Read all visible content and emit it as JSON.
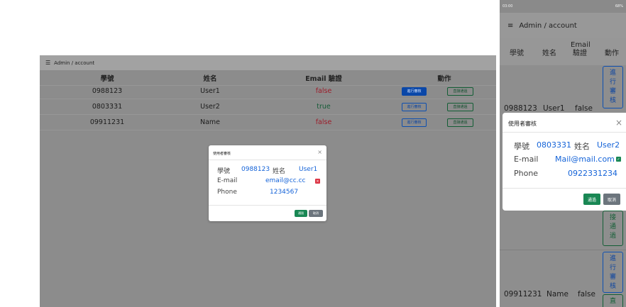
{
  "desktop": {
    "breadcrumb": "Admin / account",
    "columns": [
      "學號",
      "姓名",
      "Email 驗證",
      "動作"
    ],
    "rows": [
      {
        "id": "0988123",
        "name": "User1",
        "email_verified": "false"
      },
      {
        "id": "0803331",
        "name": "User2",
        "email_verified": "true"
      },
      {
        "id": "09911231",
        "name": "Name",
        "email_verified": "false"
      }
    ],
    "review_label": "進行審核",
    "approve_label": "直接通過",
    "modal": {
      "title": "使用者審核",
      "close": "×",
      "id_label": "學號",
      "id_value": "0988123",
      "name_label": "姓名",
      "name_value": "User1",
      "email_label": "E-mail",
      "email_value": "email@cc.cc",
      "email_flag": "×",
      "phone_label": "Phone",
      "phone_value": "1234567",
      "ok": "通過",
      "cancel": "取消"
    }
  },
  "mobile": {
    "status_time": "03:00",
    "status_right": "68%",
    "breadcrumb": "Admin / account",
    "columns": [
      "學號",
      "姓名",
      "Email 驗證",
      "動作"
    ],
    "rows": [
      {
        "id": "0988123",
        "name": "User1",
        "email_verified": "false"
      },
      {
        "id": "09911231",
        "name": "Name",
        "email_verified": "false"
      }
    ],
    "review_chars": [
      "進",
      "行",
      "審",
      "核"
    ],
    "approve_chars": [
      "接",
      "通",
      "過"
    ],
    "approve_first": "直",
    "modal": {
      "title": "使用者審核",
      "close": "×",
      "id_label": "學號",
      "id_value": "0803331",
      "name_label": "姓名",
      "name_value": "User2",
      "email_label": "E-mail",
      "email_value": "Mail@mail.com",
      "email_flag": "✓",
      "phone_label": "Phone",
      "phone_value": "0922331234",
      "ok": "通過",
      "cancel": "取消"
    }
  }
}
